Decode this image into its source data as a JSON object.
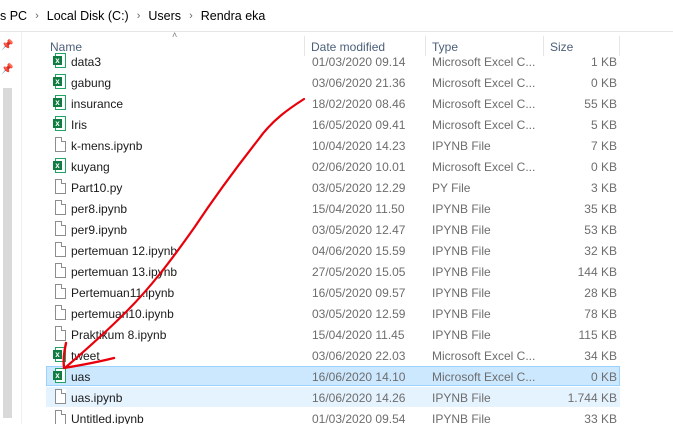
{
  "breadcrumb": [
    "s PC",
    "Local Disk (C:)",
    "Users",
    "Rendra eka"
  ],
  "columns": {
    "name": "Name",
    "date": "Date modified",
    "type": "Type",
    "size": "Size"
  },
  "files": [
    {
      "name": "data3",
      "date": "01/03/2020 09.14",
      "type": "Microsoft Excel C...",
      "size": "1 KB",
      "icon": "excel-csv-icon"
    },
    {
      "name": "gabung",
      "date": "03/06/2020 21.36",
      "type": "Microsoft Excel C...",
      "size": "0 KB",
      "icon": "excel-csv-icon"
    },
    {
      "name": "insurance",
      "date": "18/02/2020 08.46",
      "type": "Microsoft Excel C...",
      "size": "55 KB",
      "icon": "excel-csv-icon"
    },
    {
      "name": "Iris",
      "date": "16/05/2020 09.41",
      "type": "Microsoft Excel C...",
      "size": "5 KB",
      "icon": "excel-csv-icon"
    },
    {
      "name": "k-mens.ipynb",
      "date": "10/04/2020 14.23",
      "type": "IPYNB File",
      "size": "7 KB",
      "icon": "file-icon"
    },
    {
      "name": "kuyang",
      "date": "02/06/2020 10.01",
      "type": "Microsoft Excel C...",
      "size": "0 KB",
      "icon": "excel-csv-icon"
    },
    {
      "name": "Part10.py",
      "date": "03/05/2020 12.29",
      "type": "PY File",
      "size": "3 KB",
      "icon": "file-icon"
    },
    {
      "name": "per8.ipynb",
      "date": "15/04/2020 11.50",
      "type": "IPYNB File",
      "size": "35 KB",
      "icon": "file-icon"
    },
    {
      "name": "per9.ipynb",
      "date": "03/05/2020 12.47",
      "type": "IPYNB File",
      "size": "53 KB",
      "icon": "file-icon"
    },
    {
      "name": "pertemuan 12.ipynb",
      "date": "04/06/2020 15.59",
      "type": "IPYNB File",
      "size": "32 KB",
      "icon": "file-icon"
    },
    {
      "name": "pertemuan 13.ipynb",
      "date": "27/05/2020 15.05",
      "type": "IPYNB File",
      "size": "144 KB",
      "icon": "file-icon"
    },
    {
      "name": "Pertemuan11.ipynb",
      "date": "16/05/2020 09.57",
      "type": "IPYNB File",
      "size": "28 KB",
      "icon": "file-icon"
    },
    {
      "name": "pertemuan10.ipynb",
      "date": "03/05/2020 12.59",
      "type": "IPYNB File",
      "size": "78 KB",
      "icon": "file-icon"
    },
    {
      "name": "Praktikum 8.ipynb",
      "date": "15/04/2020 11.45",
      "type": "IPYNB File",
      "size": "115 KB",
      "icon": "file-icon"
    },
    {
      "name": "tweet",
      "date": "03/06/2020 22.03",
      "type": "Microsoft Excel C...",
      "size": "34 KB",
      "icon": "excel-csv-icon"
    },
    {
      "name": "uas",
      "date": "16/06/2020 14.10",
      "type": "Microsoft Excel C...",
      "size": "0 KB",
      "icon": "excel-csv-icon",
      "state": "selected"
    },
    {
      "name": "uas.ipynb",
      "date": "16/06/2020 14.26",
      "type": "IPYNB File",
      "size": "1.744 KB",
      "icon": "file-icon",
      "state": "hover"
    },
    {
      "name": "Untitled.ipynb",
      "date": "01/03/2020 09.54",
      "type": "IPYNB File",
      "size": "33 KB",
      "icon": "file-icon"
    }
  ],
  "colors": {
    "selected_bg": "#cce8ff",
    "hover_bg": "#e5f3ff",
    "annotation": "#e8000b",
    "excel_green": "#107c41"
  },
  "annotation": "red-hand-drawn-arrow-pointing-to-uas"
}
